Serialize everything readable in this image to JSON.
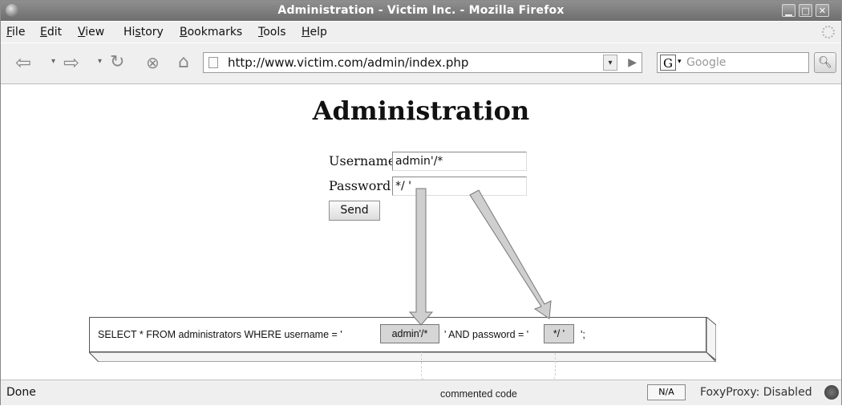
{
  "window": {
    "title": "Administration - Victim Inc. - Mozilla Firefox",
    "controls": [
      "minimize",
      "maximize",
      "close"
    ]
  },
  "menubar": {
    "items": [
      {
        "label": "File",
        "key": "F"
      },
      {
        "label": "Edit",
        "key": "E"
      },
      {
        "label": "View",
        "key": "V"
      },
      {
        "label": "History",
        "key": "s"
      },
      {
        "label": "Bookmarks",
        "key": "B"
      },
      {
        "label": "Tools",
        "key": "T"
      },
      {
        "label": "Help",
        "key": "H"
      }
    ]
  },
  "navbar": {
    "url": "http://www.victim.com/admin/index.php",
    "search_placeholder": "Google",
    "search_engine_letter": "G"
  },
  "page": {
    "title": "Administration",
    "username_label": "Username",
    "username_value": "admin'/*",
    "password_label": "Password",
    "password_value": "*/ '",
    "send_label": "Send"
  },
  "annotation": {
    "sql_prefix": "SELECT * FROM administrators WHERE username = '",
    "chip_username": "admin'/*",
    "sql_middle": "' AND password = '",
    "chip_password": "*/ '",
    "sql_suffix": "';",
    "bracket_label": "commented code"
  },
  "statusbar": {
    "status": "Done",
    "na_label": "N/A",
    "proxy_status": "FoxyProxy: Disabled"
  },
  "colors": {
    "titlebar": "#7d7d7d",
    "chrome": "#efefef",
    "chip": "#d6d6d6",
    "arrow": "#cfcfcf"
  }
}
